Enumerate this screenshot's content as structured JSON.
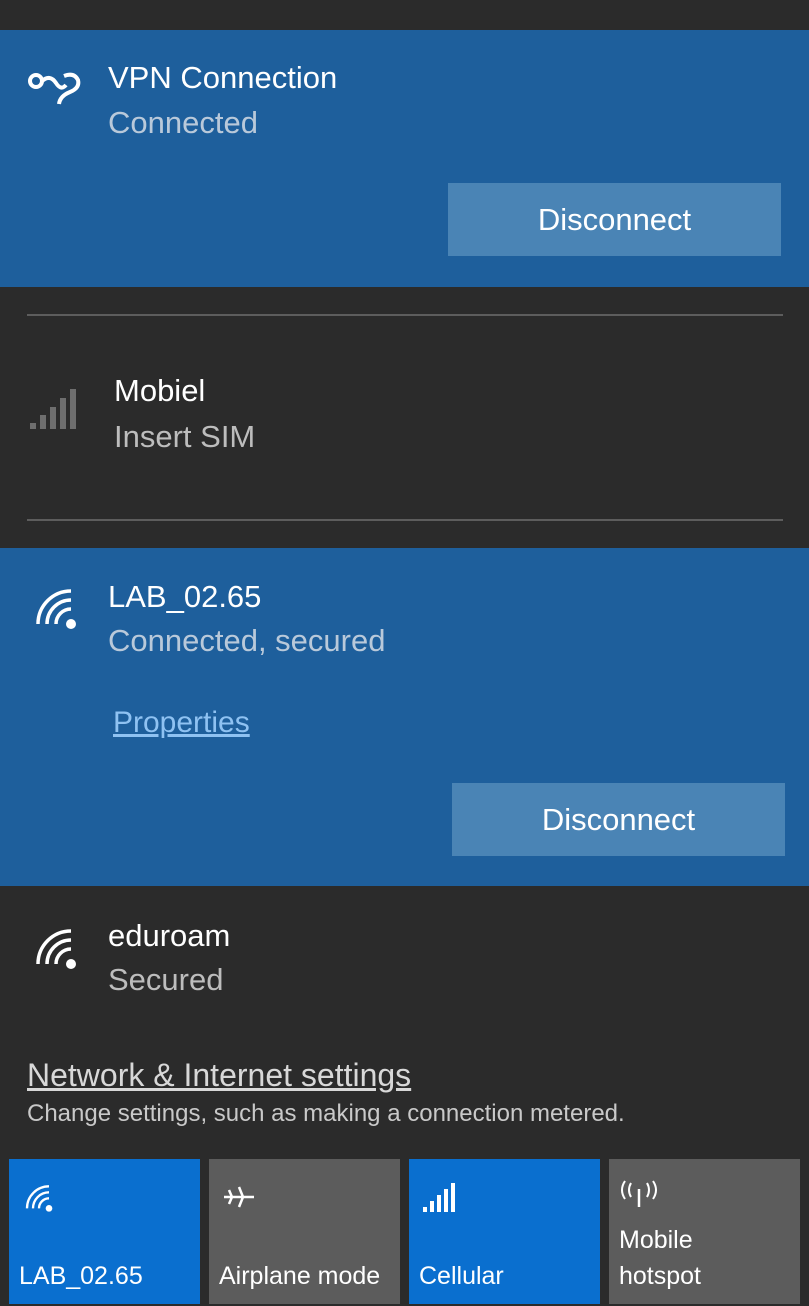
{
  "vpn": {
    "name": "VPN Connection",
    "status": "Connected",
    "disconnect_label": "Disconnect",
    "icon": "vpn-icon"
  },
  "cellular": {
    "name": "Mobiel",
    "status": "Insert SIM",
    "icon": "signal-bars-icon"
  },
  "wifi_connected": {
    "name": "LAB_02.65",
    "status": "Connected, secured",
    "properties_label": "Properties",
    "disconnect_label": "Disconnect",
    "icon": "wifi-icon"
  },
  "wifi_other": {
    "name": "eduroam",
    "status": "Secured",
    "icon": "wifi-icon"
  },
  "settings": {
    "link_label": "Network & Internet settings",
    "description": "Change settings, such as making a connection metered."
  },
  "quick_actions": [
    {
      "label": "LAB_02.65",
      "icon": "wifi-icon",
      "state": "on"
    },
    {
      "label": "Airplane mode",
      "icon": "airplane-icon",
      "state": "off"
    },
    {
      "label": "Cellular",
      "icon": "signal-bars-icon",
      "state": "on"
    },
    {
      "label": "Mobile\nhotspot",
      "icon": "hotspot-icon",
      "state": "off"
    }
  ],
  "colors": {
    "background": "#2b2b2b",
    "selected": "#1e5f9c",
    "button": "#4a84b5",
    "tile_on": "#0a6fcf",
    "tile_off": "#5c5c5c"
  }
}
